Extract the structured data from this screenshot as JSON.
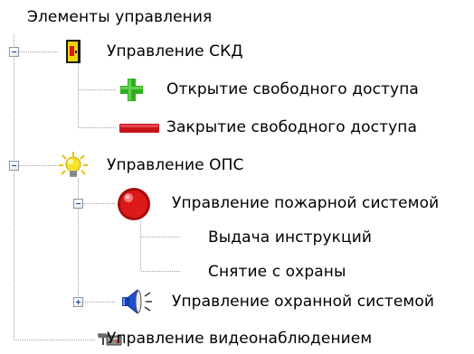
{
  "tree": {
    "root": {
      "label": "Элементы управления"
    },
    "skd": {
      "label": "Управление СКД",
      "expanded": true,
      "icon": "door-icon",
      "children": [
        {
          "label": "Открытие свободного доступа",
          "icon": "plus-icon"
        },
        {
          "label": "Закрытие свободного доступа",
          "icon": "minus-icon"
        }
      ]
    },
    "ops": {
      "label": "Управление ОПС",
      "expanded": true,
      "icon": "lightbulb-icon",
      "fire": {
        "label": "Управление пожарной системой",
        "expanded": true,
        "icon": "red-lamp-icon",
        "children": [
          {
            "label": "Выдача инструкций"
          },
          {
            "label": "Снятие с охраны"
          }
        ]
      },
      "security": {
        "label": "Управление охранной системой",
        "expanded": false,
        "icon": "speaker-icon"
      }
    },
    "video": {
      "label": "Управление видеонаблюдением",
      "icon": "camera-icon"
    }
  },
  "colors": {
    "tree_line": "#a0a0a0",
    "toggle_border": "#8a95a8",
    "toggle_sign": "#1d3a8c",
    "plus_icon": "#2fae21",
    "minus_icon": "#d4141c",
    "lamp": "#d61a1a",
    "bulb": "#f4e21c"
  }
}
